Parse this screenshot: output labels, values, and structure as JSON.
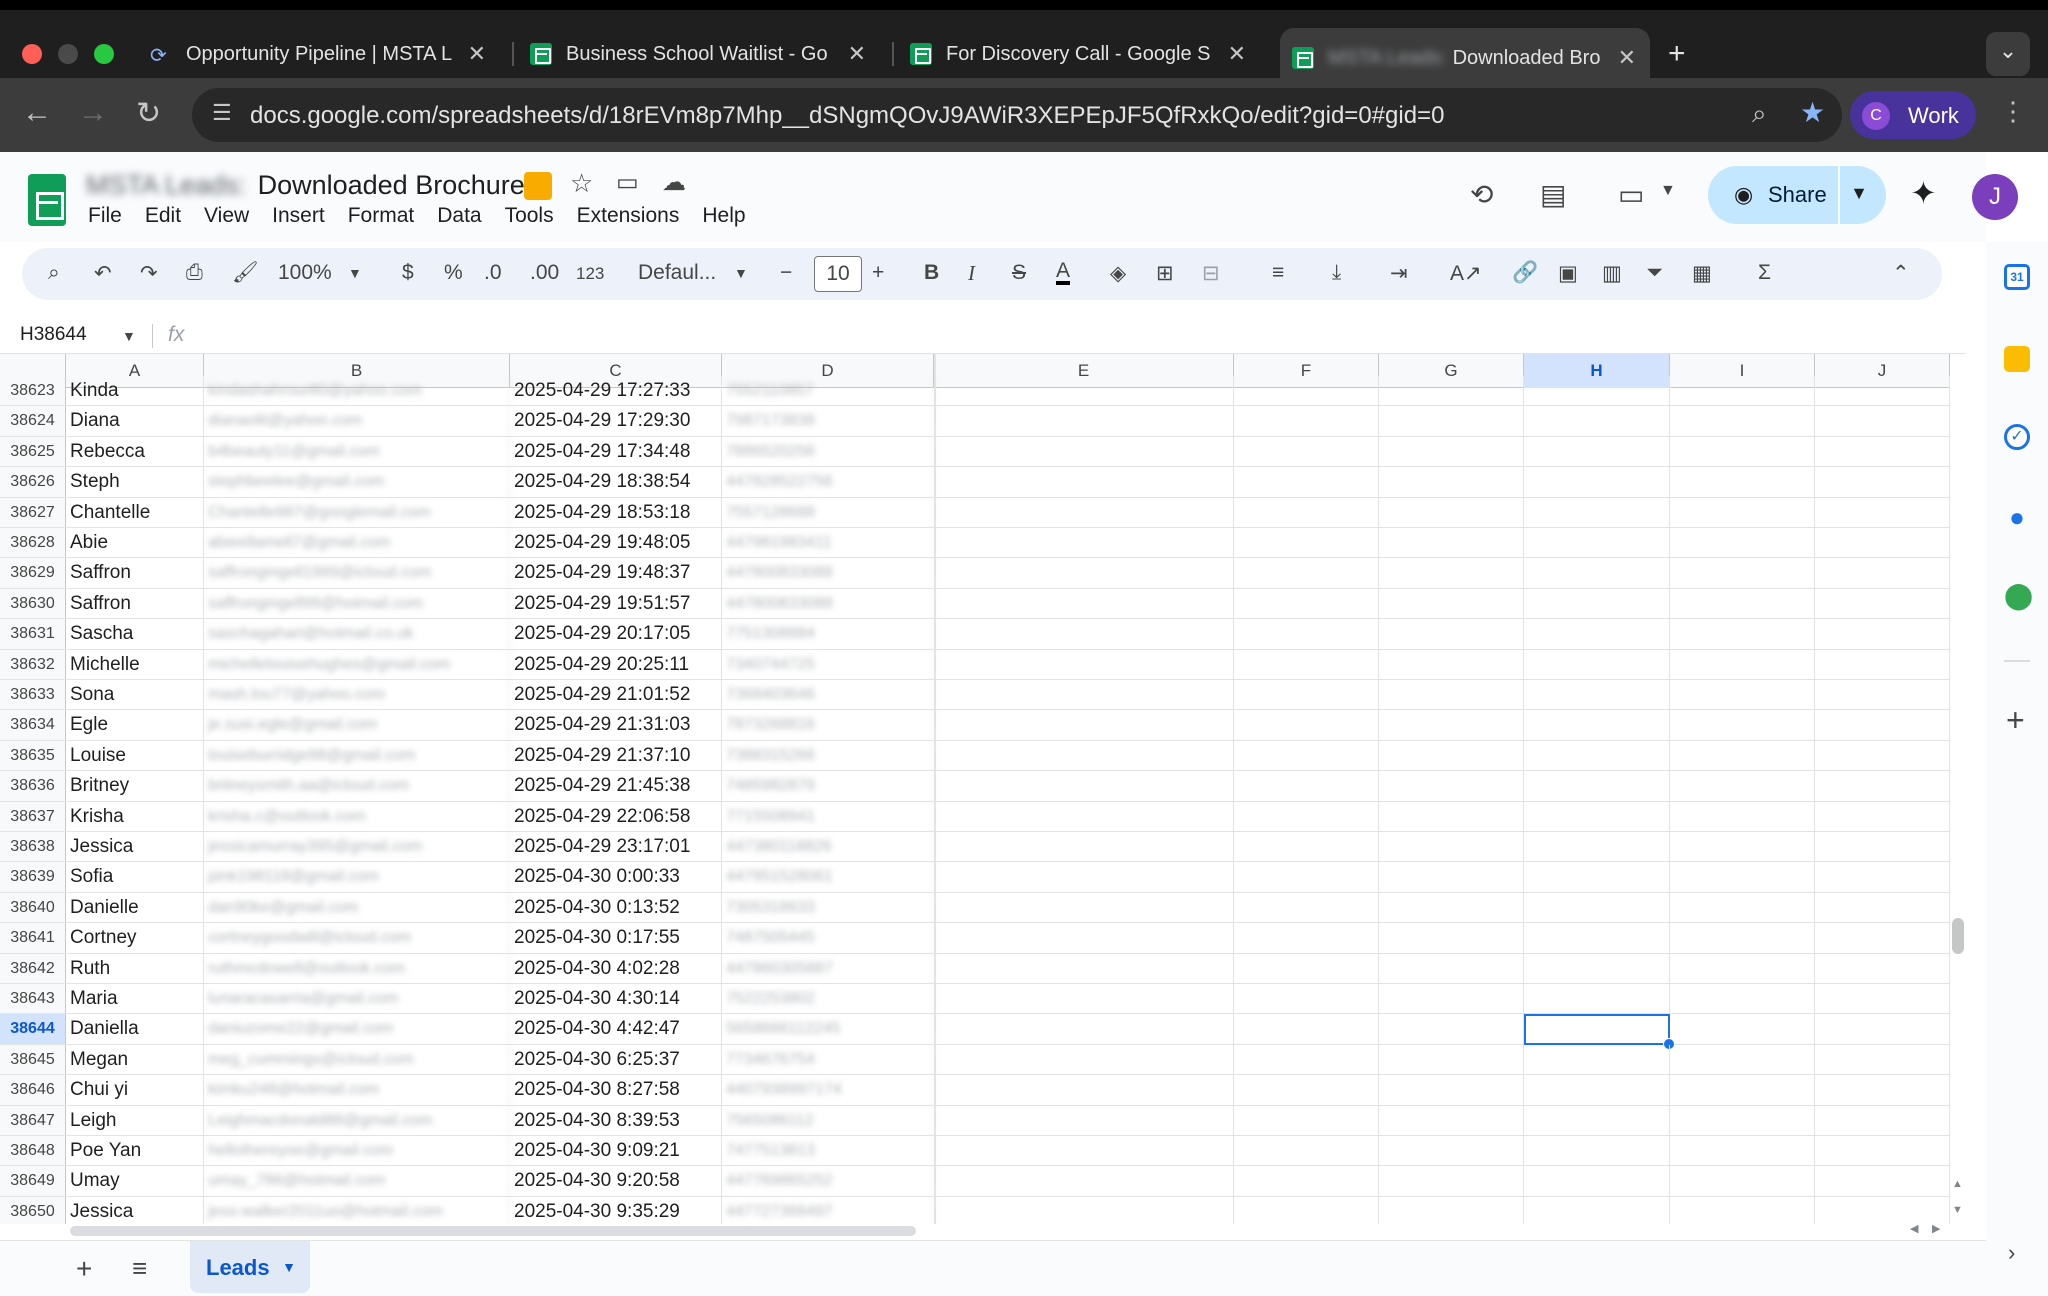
{
  "browser": {
    "tabs": [
      {
        "title": "Opportunity Pipeline | MSTA L",
        "icon": "sync-favicon"
      },
      {
        "title": "Business School Waitlist - Go",
        "icon": "sheets-favicon"
      },
      {
        "title": "For Discovery Call - Google S",
        "icon": "sheets-favicon"
      },
      {
        "title_blurred": "MSTA Leads:",
        "title": "Downloaded Bro",
        "icon": "sheets-favicon"
      }
    ],
    "new_tab": "+",
    "tab_menu": "⌄",
    "url": "docs.google.com/spreadsheets/d/18rEVm8p7Mhp__dSNgmQOvJ9AWiR3XEPEpJF5QfRxkQo/edit?gid=0#gid=0",
    "profile_initial": "C",
    "profile_label": "Work"
  },
  "sheet": {
    "title_blurred": "MSTA Leads:",
    "title": "Downloaded Brochure",
    "menu": [
      "File",
      "Edit",
      "View",
      "Insert",
      "Format",
      "Data",
      "Tools",
      "Extensions",
      "Help"
    ],
    "share_label": "Share",
    "user_initial": "J"
  },
  "toolbar": {
    "zoom": "100%",
    "currency": "$",
    "percent": "%",
    "dec_decrease": ".0",
    "dec_increase": ".00",
    "number_format": "123",
    "font": "Defaul...",
    "font_size": "10",
    "bold": "B",
    "italic": "I",
    "strikethrough": "S",
    "text_color": "A",
    "sum": "Σ"
  },
  "formula_bar": {
    "name_box": "H38644",
    "fx": "fx",
    "value": ""
  },
  "columns": [
    "A",
    "B",
    "C",
    "D",
    "E",
    "F",
    "G",
    "H",
    "I",
    "J"
  ],
  "selected_column": "H",
  "selected_row": "38644",
  "rows": [
    {
      "n": "38623",
      "a": "Kinda",
      "b": "kindashahrour80@yahoo.com",
      "c": "2025-04-29 17:27:33",
      "d": "7552110857"
    },
    {
      "n": "38624",
      "a": "Diana",
      "b": "dianaolit@yahoo.com",
      "c": "2025-04-29 17:29:30",
      "d": "7987173838"
    },
    {
      "n": "38625",
      "a": "Rebecca",
      "b": "b4beauty11@gmail.com",
      "c": "2025-04-29 17:34:48",
      "d": "7886520256"
    },
    {
      "n": "38626",
      "a": "Steph",
      "b": "stephbeelee@gmail.com",
      "c": "2025-04-29 18:38:54",
      "d": "447828522756"
    },
    {
      "n": "38627",
      "a": "Chantelle",
      "b": "Chantelle987@googlemail.com",
      "c": "2025-04-29 18:53:18",
      "d": "7557128688"
    },
    {
      "n": "38628",
      "a": "Abie",
      "b": "abieellamell7@gmail.com",
      "c": "2025-04-29 19:48:05",
      "d": "447981983411"
    },
    {
      "n": "38629",
      "a": "Saffron",
      "b": "saffrongingell1999@icloud.com",
      "c": "2025-04-29 19:48:37",
      "d": "447800833088"
    },
    {
      "n": "38630",
      "a": "Saffron",
      "b": "saffrongingell99@hotmail.com",
      "c": "2025-04-29 19:51:57",
      "d": "447800833088"
    },
    {
      "n": "38631",
      "a": "Sascha",
      "b": "saschagahari@hotmail.co.uk",
      "c": "2025-04-29 20:17:05",
      "d": "7751308884"
    },
    {
      "n": "38632",
      "a": "Michelle",
      "b": "michellelouisehughes@gmail.com",
      "c": "2025-04-29 20:25:11",
      "d": "7340744725"
    },
    {
      "n": "38633",
      "a": "Sona",
      "b": "mash.lou77@yahoo.com",
      "c": "2025-04-29 21:01:52",
      "d": "7368403646"
    },
    {
      "n": "38634",
      "a": "Egle",
      "b": "je.susi.egle@gmail.com",
      "c": "2025-04-29 21:31:03",
      "d": "7873268816"
    },
    {
      "n": "38635",
      "a": "Louise",
      "b": "louiseburridge98@gmail.com",
      "c": "2025-04-29 21:37:10",
      "d": "7388315266"
    },
    {
      "n": "38636",
      "a": "Britney",
      "b": "britneysmith.aa@icloud.com",
      "c": "2025-04-29 21:45:38",
      "d": "7485982879"
    },
    {
      "n": "38637",
      "a": "Krisha",
      "b": "krisha.c@outlook.com",
      "c": "2025-04-29 22:06:58",
      "d": "7715508941"
    },
    {
      "n": "38638",
      "a": "Jessica",
      "b": "jessicamurray395@gmail.com",
      "c": "2025-04-29 23:17:01",
      "d": "447380118826"
    },
    {
      "n": "38639",
      "a": "Sofia",
      "b": "pink198118@gmail.com",
      "c": "2025-04-30 0:00:33",
      "d": "447951528061"
    },
    {
      "n": "38640",
      "a": "Danielle",
      "b": "dan90ke@gmail.com",
      "c": "2025-04-30 0:13:52",
      "d": "7305318633"
    },
    {
      "n": "38641",
      "a": "Cortney",
      "b": "cortneygoodwill@icloud.com",
      "c": "2025-04-30 0:17:55",
      "d": "7487505445"
    },
    {
      "n": "38642",
      "a": "Ruth",
      "b": "ruthmcdowell@outlook.com",
      "c": "2025-04-30 4:02:28",
      "d": "447860305887"
    },
    {
      "n": "38643",
      "a": "Maria",
      "b": "lunaracasarria@gmail.com",
      "c": "2025-04-30 4:30:14",
      "d": "7522253802"
    },
    {
      "n": "38644",
      "a": "Daniella",
      "b": "daniuzome22@gmail.com",
      "c": "2025-04-30 4:42:47",
      "d": "5658666112245"
    },
    {
      "n": "38645",
      "a": "Megan",
      "b": "meg_cummings@icloud.com",
      "c": "2025-04-30 6:25:37",
      "d": "7734676754"
    },
    {
      "n": "38646",
      "a": "Chui yi",
      "b": "kimku248@hotmail.com",
      "c": "2025-04-30 8:27:58",
      "d": "4407938997174"
    },
    {
      "n": "38647",
      "a": "Leigh",
      "b": "Leighmacdonald88@gmail.com",
      "c": "2025-04-30 8:39:53",
      "d": "7565086112"
    },
    {
      "n": "38648",
      "a": "Poe Yan",
      "b": "hellothereyoe@gmail.com",
      "c": "2025-04-30 9:09:21",
      "d": "7477513813"
    },
    {
      "n": "38649",
      "a": "Umay",
      "b": "umay_786@hotmail.com",
      "c": "2025-04-30 9:20:58",
      "d": "447769865252"
    },
    {
      "n": "38650",
      "a": "Jessica",
      "b": "jess-walker2011uo@hotmail.com",
      "c": "2025-04-30 9:35:29",
      "d": "447727366497"
    }
  ],
  "sheet_tabs": [
    {
      "label": "Leads"
    }
  ],
  "colors": {
    "accent": "#1a73e8",
    "selected_header": "#d3e3fd",
    "share_button": "#c2e7ff",
    "sheets_green": "#0f9d58"
  }
}
